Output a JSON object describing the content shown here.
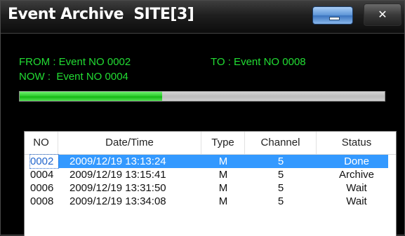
{
  "window": {
    "title": "Event Archive  SITE[3]",
    "close_glyph": "✕",
    "minimize_icon": "minimize-icon",
    "close_icon": "close-icon"
  },
  "info": {
    "from_label": "FROM : Event NO 0002",
    "to_label": "TO : Event NO 0008",
    "now_label": "NOW :  Event NO 0004",
    "text_color": "#22dd33"
  },
  "progress": {
    "value_percent": 39,
    "fill_color": "#2fcf2f"
  },
  "table": {
    "columns": [
      "NO",
      "Date/Time",
      "Type",
      "Channel",
      "Status"
    ],
    "rows": [
      {
        "no": "0002",
        "datetime": "2009/12/19 13:13:24",
        "type": "M",
        "channel": "5",
        "status": "Done",
        "selected": true
      },
      {
        "no": "0004",
        "datetime": "2009/12/19 13:15:41",
        "type": "M",
        "channel": "5",
        "status": "Archive",
        "selected": false
      },
      {
        "no": "0006",
        "datetime": "2009/12/19 13:31:50",
        "type": "M",
        "channel": "5",
        "status": "Wait",
        "selected": false
      },
      {
        "no": "0008",
        "datetime": "2009/12/19 13:34:08",
        "type": "M",
        "channel": "5",
        "status": "Wait",
        "selected": false
      }
    ],
    "selection_color": "#3399ff"
  }
}
